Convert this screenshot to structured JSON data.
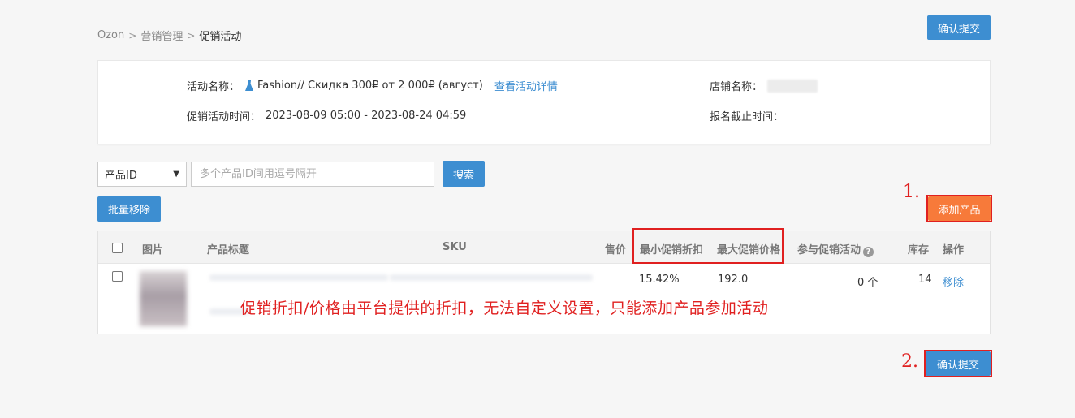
{
  "breadcrumb": [
    "Ozon",
    "营销管理",
    "促销活动"
  ],
  "header": {
    "submit_label": "确认提交"
  },
  "info": {
    "activity_name_label": "活动名称：",
    "activity_name": "Fashion// Скидка 300₽ от 2 000₽ (август)",
    "activity_detail_link": "查看活动详情",
    "activity_time_label": "促销活动时间：",
    "activity_time": "2023-08-09 05:00 - 2023-08-24 04:59",
    "shop_name_label": "店铺名称：",
    "deadline_label": "报名截止时间："
  },
  "search": {
    "select_value": "产品ID",
    "placeholder": "多个产品ID间用逗号隔开",
    "search_label": "搜索"
  },
  "actions": {
    "batch_remove_label": "批量移除",
    "add_product_label": "添加产品"
  },
  "table": {
    "headers": {
      "image": "图片",
      "title": "产品标题",
      "sku": "SKU",
      "price": "售价",
      "min_discount": "最小促销折扣",
      "max_price": "最大促销价格",
      "join_activity": "参与促销活动",
      "stock": "库存",
      "action": "操作"
    },
    "rows": [
      {
        "min_discount": "15.42%",
        "max_price": "192.0",
        "join_activity": "0 个",
        "stock": "14",
        "action": "移除"
      }
    ]
  },
  "footer": {
    "submit_label": "确认提交"
  },
  "annotations": {
    "step1": "1.",
    "step2": "2.",
    "note": "促销折扣/价格由平台提供的折扣，无法自定义设置，只能添加产品参加活动"
  },
  "colors": {
    "primary": "#3d8ed1",
    "accent": "#f77a3a",
    "annotation": "#e02020"
  }
}
